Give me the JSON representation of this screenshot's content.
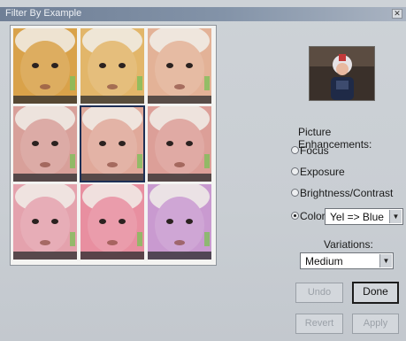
{
  "window": {
    "title": "Filter By Example"
  },
  "grid": {
    "thumbnails": [
      {
        "name": "thumb-orange",
        "tint": "#d9a24a",
        "selected": false
      },
      {
        "name": "thumb-yellow",
        "tint": "#e2b66a",
        "selected": false
      },
      {
        "name": "thumb-peach",
        "tint": "#e3b297",
        "selected": false
      },
      {
        "name": "thumb-rose",
        "tint": "#d8a09a",
        "selected": false
      },
      {
        "name": "thumb-center",
        "tint": "#e0a99a",
        "selected": true
      },
      {
        "name": "thumb-pink",
        "tint": "#dc9f98",
        "selected": false
      },
      {
        "name": "thumb-magenta",
        "tint": "#e4a2ad",
        "selected": false
      },
      {
        "name": "thumb-hotpink",
        "tint": "#e88fa0",
        "selected": false
      },
      {
        "name": "thumb-violet",
        "tint": "#c99ad0",
        "selected": false
      }
    ]
  },
  "enhancements": {
    "label": "Picture Enhancements:",
    "options": [
      {
        "label": "Focus",
        "checked": false
      },
      {
        "label": "Exposure",
        "checked": false
      },
      {
        "label": "Brightness/Contrast",
        "checked": false
      },
      {
        "label": "Color",
        "checked": true
      }
    ],
    "color_select": "Yel => Blue"
  },
  "variations": {
    "label": "Variations:",
    "select": "Medium"
  },
  "buttons": {
    "undo": "Undo",
    "done": "Done",
    "revert": "Revert",
    "apply": "Apply"
  }
}
